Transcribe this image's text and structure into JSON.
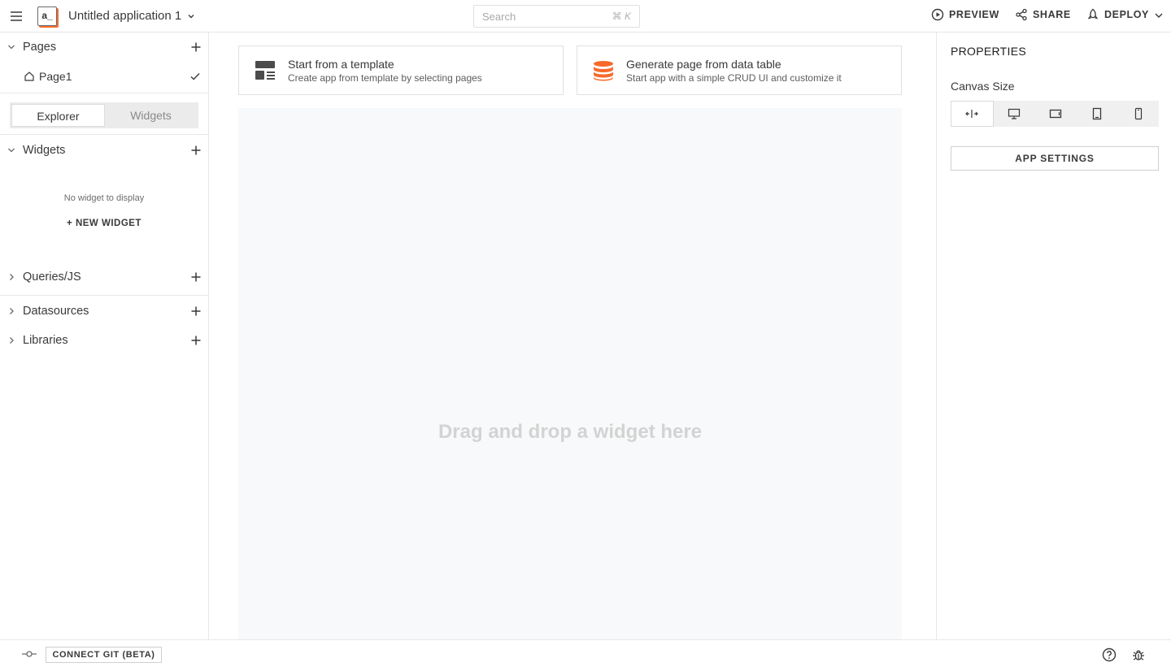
{
  "header": {
    "app_name": "Untitled application 1",
    "logo_text": "a_",
    "search_placeholder": "Search",
    "search_shortcut": "⌘ K",
    "preview_label": "PREVIEW",
    "share_label": "SHARE",
    "deploy_label": "DEPLOY"
  },
  "sidebar": {
    "pages_label": "Pages",
    "pages": [
      {
        "name": "Page1"
      }
    ],
    "tabs": {
      "explorer": "Explorer",
      "widgets": "Widgets"
    },
    "widgets_label": "Widgets",
    "no_widget_text": "No widget to display",
    "new_widget_label": "+ NEW WIDGET",
    "queries_label": "Queries/JS",
    "datasources_label": "Datasources",
    "libraries_label": "Libraries"
  },
  "main": {
    "template_card": {
      "title": "Start from a template",
      "subtitle": "Create app from template by selecting pages"
    },
    "datatable_card": {
      "title": "Generate page from data table",
      "subtitle": "Start app with a simple CRUD UI and customize it"
    },
    "canvas_placeholder": "Drag and drop a widget here"
  },
  "properties": {
    "title": "PROPERTIES",
    "canvas_size_label": "Canvas Size",
    "app_settings_label": "APP SETTINGS"
  },
  "bottom": {
    "connect_git_label": "CONNECT GIT (BETA)"
  },
  "colors": {
    "accent": "#f86a2b",
    "canvas_bg": "#f8f9fa"
  }
}
